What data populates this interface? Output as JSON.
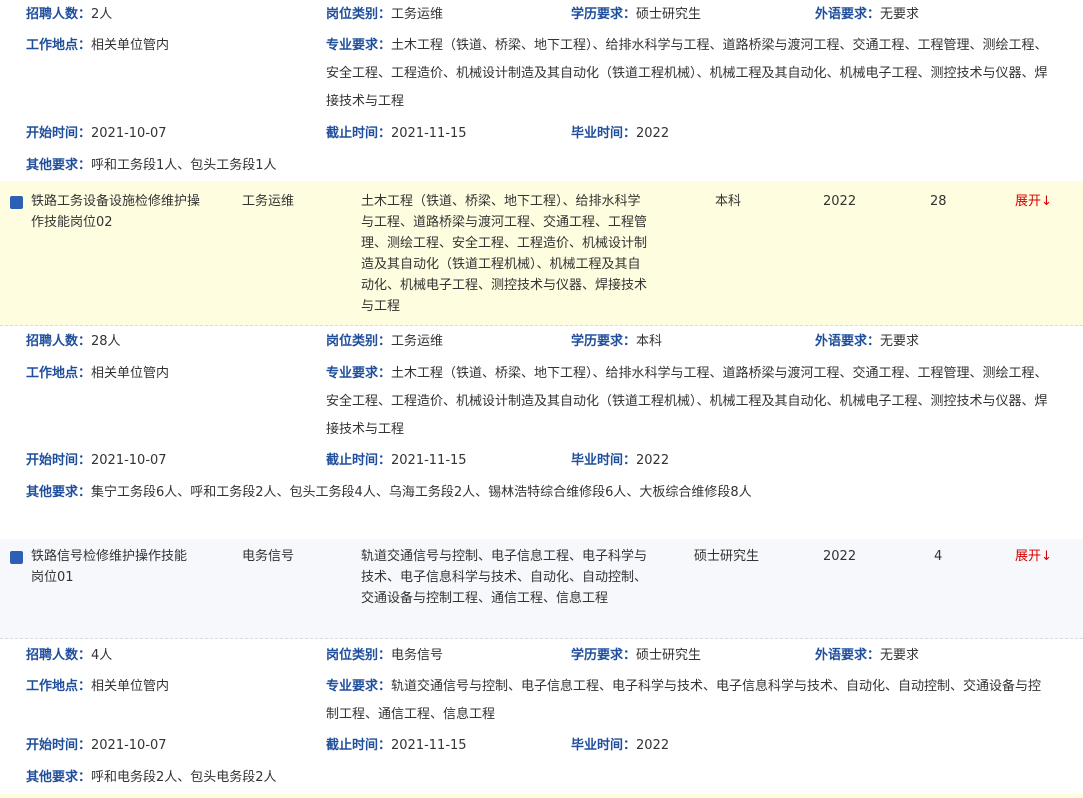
{
  "labels": {
    "count": "招聘人数：",
    "category": "岗位类别：",
    "education": "学历要求：",
    "language": "外语要求：",
    "location": "工作地点：",
    "major": "专业要求：",
    "start": "开始时间：",
    "end": "截止时间：",
    "grad": "毕业时间：",
    "other": "其他要求："
  },
  "details": [
    {
      "count": "2人",
      "category": "工务运维",
      "education": "硕士研究生",
      "language": "无要求",
      "location": "相关单位管内",
      "major": "土木工程（铁道、桥梁、地下工程）、给排水科学与工程、道路桥梁与渡河工程、交通工程、工程管理、测绘工程、安全工程、工程造价、机械设计制造及其自动化（铁道工程机械）、机械工程及其自动化、机械电子工程、测控技术与仪器、焊接技术与工程",
      "start": "2021-10-07",
      "end": "2021-11-15",
      "grad": "2022",
      "other": "呼和工务段1人、包头工务段1人"
    },
    {
      "count": "28人",
      "category": "工务运维",
      "education": "本科",
      "language": "无要求",
      "location": "相关单位管内",
      "major": "土木工程（铁道、桥梁、地下工程）、给排水科学与工程、道路桥梁与渡河工程、交通工程、工程管理、测绘工程、安全工程、工程造价、机械设计制造及其自动化（铁道工程机械）、机械工程及其自动化、机械电子工程、测控技术与仪器、焊接技术与工程",
      "start": "2021-10-07",
      "end": "2021-11-15",
      "grad": "2022",
      "other": "集宁工务段6人、呼和工务段2人、包头工务段4人、乌海工务段2人、锡林浩特综合维修段6人、大板综合维修段8人"
    },
    {
      "count": "4人",
      "category": "电务信号",
      "education": "硕士研究生",
      "language": "无要求",
      "location": "相关单位管内",
      "major": "轨道交通信号与控制、电子信息工程、电子科学与技术、电子信息科学与技术、自动化、自动控制、交通设备与控制工程、通信工程、信息工程",
      "start": "2021-10-07",
      "end": "2021-11-15",
      "grad": "2022",
      "other": "呼和电务段2人、包头电务段2人"
    }
  ],
  "rows": [
    {
      "name": "铁路工务设备设施检修维护操作技能岗位02",
      "category": "工务运维",
      "major": "土木工程（铁道、桥梁、地下工程）、给排水科学与工程、道路桥梁与渡河工程、交通工程、工程管理、测绘工程、安全工程、工程造价、机械设计制造及其自动化（铁道工程机械）、机械工程及其自动化、机械电子工程、测控技术与仪器、焊接技术与工程",
      "education": "本科",
      "year": "2022",
      "count": "28",
      "expand": "展开↓"
    },
    {
      "name": "铁路信号检修维护操作技能岗位01",
      "category": "电务信号",
      "major": "轨道交通信号与控制、电子信息工程、电子科学与技术、电子信息科学与技术、自动化、自动控制、交通设备与控制工程、通信工程、信息工程",
      "education": "硕士研究生",
      "year": "2022",
      "count": "4",
      "expand": "展开↓"
    }
  ]
}
